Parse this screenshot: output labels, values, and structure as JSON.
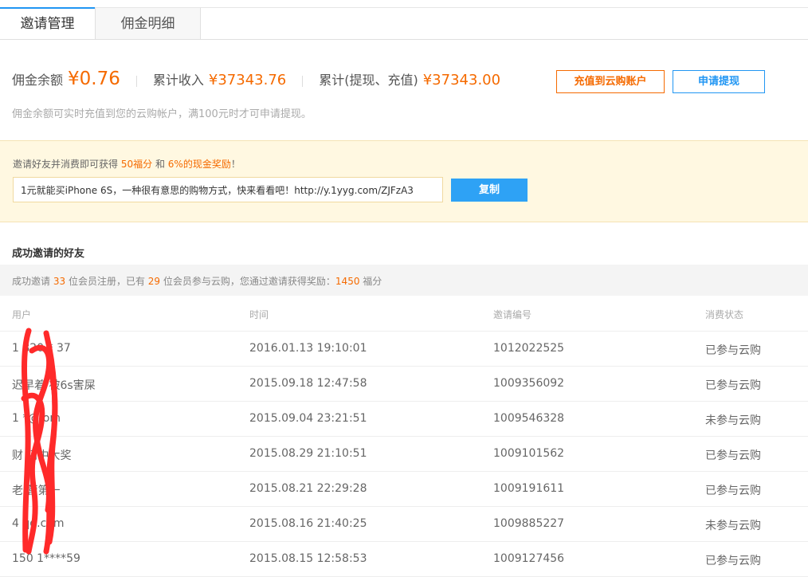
{
  "tabs": [
    {
      "label": "邀请管理",
      "active": true
    },
    {
      "label": "佣金明细",
      "active": false
    }
  ],
  "summary": {
    "balance_label": "佣金余额",
    "balance_value": "¥0.76",
    "income_label": "累计收入",
    "income_value": "¥37343.76",
    "withdraw_label": "累计(提现、充值)",
    "withdraw_value": "¥37343.00",
    "recharge_button": "充值到云购账户",
    "withdraw_button": "申请提现",
    "note": "佣金余额可实时充值到您的云购帐户，满100元时才可申请提现。"
  },
  "invite": {
    "tip_prefix": "邀请好友并消费即可获得",
    "tip_points": "50福分",
    "tip_and": "和",
    "tip_cash": "6%的现金奖励",
    "tip_suffix": "！",
    "link_value": "1元就能买iPhone 6S，一种很有意思的购物方式，快来看看吧！http://y.1yyg.com/ZJFzA3",
    "copy_button": "复制"
  },
  "friends": {
    "title": "成功邀请的好友",
    "stats": {
      "p1": "成功邀请",
      "registered": "33",
      "p2": "位会员注册，已有",
      "participated": "29",
      "p3": "位会员参与云购，您通过邀请获得奖励：",
      "points": "1450",
      "p4": "福分"
    },
    "columns": [
      "用户",
      "时间",
      "邀请编号",
      "消费状态"
    ],
    "rows": [
      {
        "user": "1 820 * 37",
        "time": "2016.01.13 19:10:01",
        "code": "1012022525",
        "status": "已参与云购"
      },
      {
        "user": "迟早着 被6s害屎",
        "time": "2015.09.18 12:47:58",
        "code": "1009356092",
        "status": "已参与云购"
      },
      {
        "user": "1 *@ om",
        "time": "2015.09.04 23:21:51",
        "code": "1009546328",
        "status": "未参与云购"
      },
      {
        "user": "财 阿中大奖",
        "time": "2015.08.29 21:10:51",
        "code": "1009101562",
        "status": "已参与云购"
      },
      {
        "user": "老 营第一",
        "time": "2015.08.21 22:29:28",
        "code": "1009191611",
        "status": "已参与云购"
      },
      {
        "user": "4 qq.com",
        "time": "2015.08.16 21:40:25",
        "code": "1009885227",
        "status": "未参与云购"
      },
      {
        "user": "150 1****59",
        "time": "2015.08.15 12:58:53",
        "code": "1009127456",
        "status": "已参与云购"
      }
    ]
  },
  "colors": {
    "accent_orange": "#f56a00",
    "accent_blue": "#2196f3",
    "scribble": "#ff2a2a"
  }
}
